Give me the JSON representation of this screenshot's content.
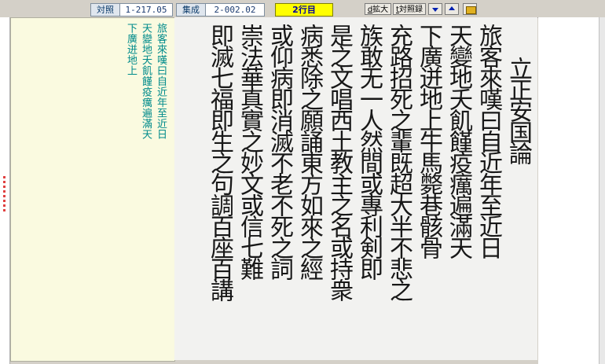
{
  "toolbar": {
    "ref_label": "対照",
    "ref_value": "1-217.05",
    "collection_label": "集成",
    "collection_value": "2-002.02",
    "line_indicator": "2行目",
    "zoom_button": "拡大",
    "zoom_key": "d",
    "compare_button": "対照録",
    "compare_key": "t"
  },
  "transcription": {
    "columns": [
      "旅客來嘆曰自近年至近日",
      "天變地夭飢饉疫癘遍滿天",
      "下廣迸地上"
    ]
  },
  "manuscript": {
    "columns": [
      "立正安国論",
      "旅客來嘆曰自近年至近日",
      "天變地夭飢饉疫癘遍滿天",
      "下廣迸地上牛馬斃巷骸骨",
      "充路招死之輩既超大半不悲之",
      "族敢无一人然間或專利剣即",
      "是之文唱西土教主之名或持衆",
      "病悉除之願誦東方如來之經",
      "或仰病即消滅不老不死之詞",
      "崇法華真實之妙文或信七難",
      "即滅七福即生之句調百座百講"
    ]
  }
}
